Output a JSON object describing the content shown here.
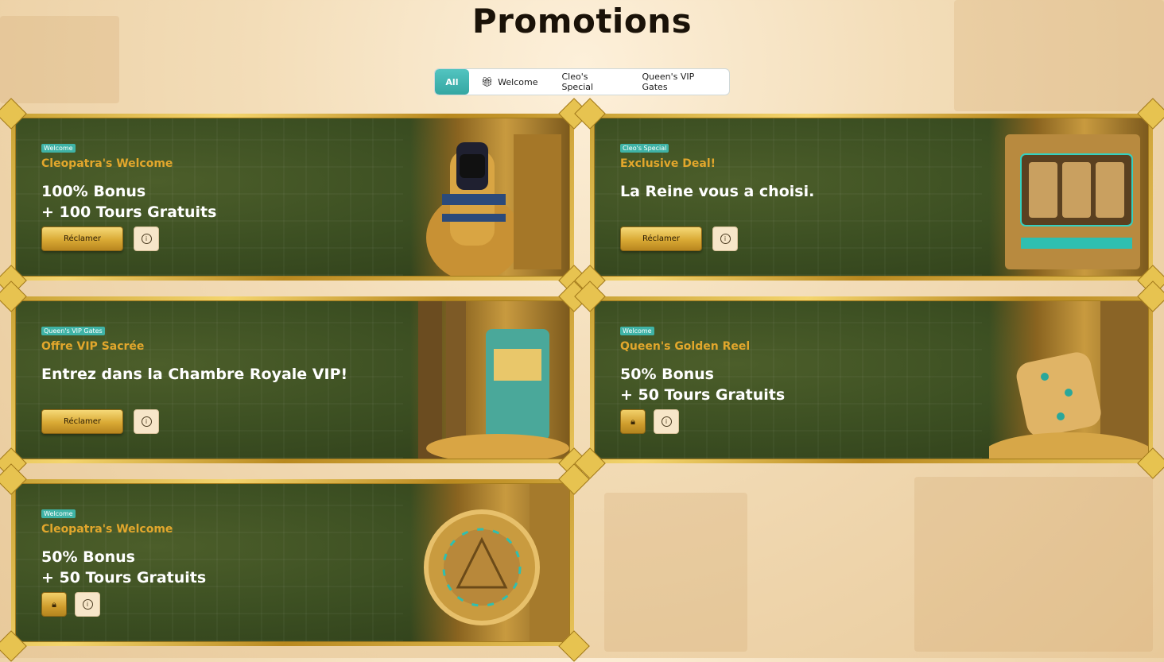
{
  "page": {
    "title": "Promotions"
  },
  "tabs": [
    {
      "label": "All",
      "active": true
    },
    {
      "label": "Welcome",
      "icon": "gift-icon"
    },
    {
      "label": "Cleo's Special"
    },
    {
      "label": "Queen's VIP Gates"
    }
  ],
  "cards": [
    {
      "badge": "Welcome",
      "subtitle": "Cleopatra's Welcome",
      "line1": "100% Bonus",
      "line2": "+ 100 Tours Gratuits",
      "action": "claim",
      "claim_label": "Réclamer",
      "art": "pharaoh-sarcophagus"
    },
    {
      "badge": "Cleo's Special",
      "subtitle": "Exclusive Deal!",
      "line1": "La Reine vous a choisi.",
      "line2": "",
      "action": "claim",
      "claim_label": "Réclamer",
      "art": "egyptian-slot-machine"
    },
    {
      "badge": "Queen's VIP Gates",
      "subtitle": "Offre VIP Sacrée",
      "line1": "Entrez dans la Chambre Royale VIP!",
      "line2": "",
      "action": "claim",
      "claim_label": "Réclamer",
      "art": "temple-slot-machine"
    },
    {
      "badge": "Welcome",
      "subtitle": "Queen's Golden Reel",
      "line1": "50% Bonus",
      "line2": "+ 50 Tours Gratuits",
      "action": "locked",
      "claim_label": "",
      "art": "golden-dice"
    },
    {
      "badge": "Welcome",
      "subtitle": "Cleopatra's Welcome",
      "line1": "50% Bonus",
      "line2": "+ 50 Tours Gratuits",
      "action": "locked",
      "claim_label": "",
      "art": "golden-chip-1000"
    }
  ],
  "colors": {
    "accent_teal": "#3fb3a6",
    "gold": "#e2a72c",
    "card_green": "#3c4f22"
  }
}
